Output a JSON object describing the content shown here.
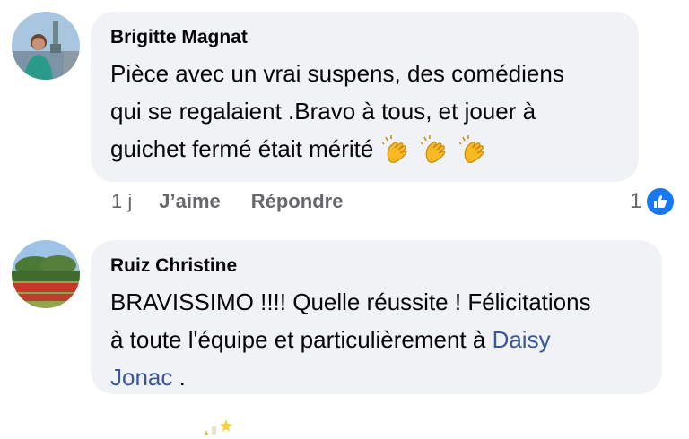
{
  "comments": [
    {
      "author": "Brigitte Magnat",
      "text_lines": [
        "Pièce avec un vrai suspens, des comédiens",
        "qui se regalaient  .Bravo à tous, et jouer à",
        "guichet fermé était mérité"
      ],
      "emoji": "clapping-hands",
      "time": "1 j",
      "like_label": "J’aime",
      "reply_label": "Répondre",
      "reaction_count": "1"
    },
    {
      "author": "Ruiz Christine",
      "text_lines": [
        "BRAVISSIMO !!!! Quelle réussite ! Félicitations",
        "à toute l'équipe et particulièrement à "
      ],
      "mention_part1": "Daisy",
      "mention_part2": "Jonac",
      "text_end": " ."
    }
  ],
  "colors": {
    "bubble": "#f0f2f5",
    "text": "#050505",
    "secondary": "#65676b",
    "mention": "#385898",
    "like_blue": "#1877f2"
  },
  "icons": [
    "clapping-hands-icon",
    "like-thumbs-up-icon"
  ]
}
